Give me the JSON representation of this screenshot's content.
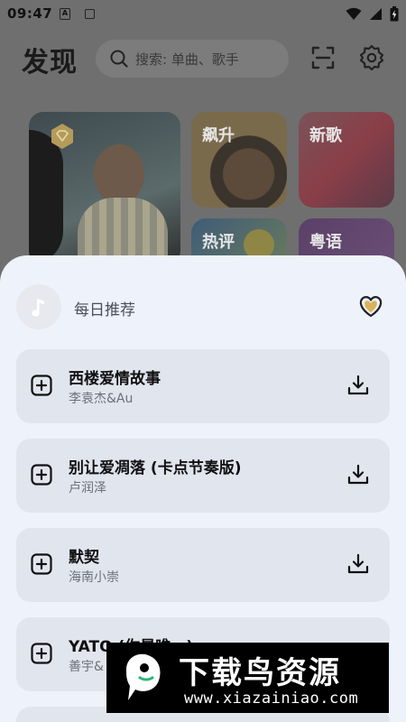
{
  "status_bar": {
    "time": "09:47",
    "notif_a": "A"
  },
  "header": {
    "logo": "发现",
    "search_placeholder": "搜索: 单曲、歌手"
  },
  "cards": [
    {
      "label": ""
    },
    {
      "label": "飙升"
    },
    {
      "label": "新歌"
    },
    {
      "label": "热评"
    },
    {
      "label": "粤语"
    }
  ],
  "sheet": {
    "title": "每日推荐",
    "songs": [
      {
        "title": "西楼爱情故事",
        "artist": "李袁杰&Au"
      },
      {
        "title": "别让爱凋落 (卡点节奏版)",
        "artist": "卢润泽"
      },
      {
        "title": "默契",
        "artist": "海南小崇"
      },
      {
        "title": "YATO (你是唯一)",
        "artist": "善宇&"
      }
    ]
  },
  "watermark": {
    "brand": "下载鸟资源",
    "url": "www.xiazainiao.com"
  }
}
